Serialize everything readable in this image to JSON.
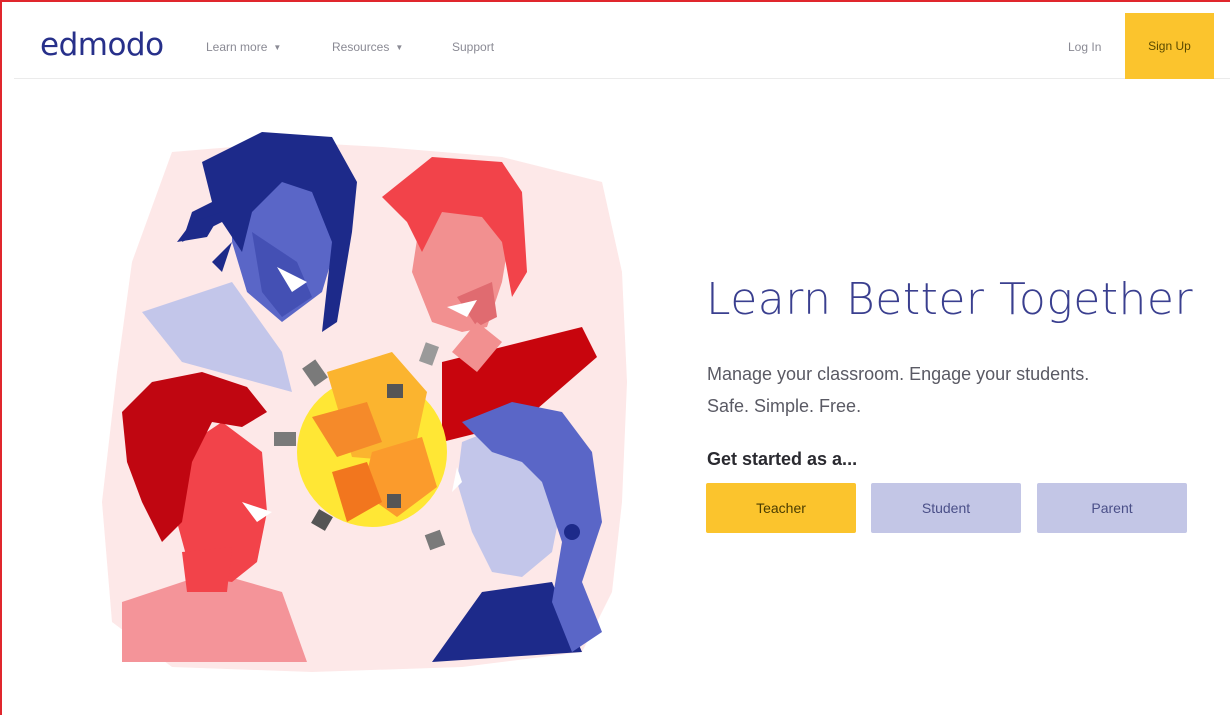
{
  "nav": {
    "logo": "edmodo",
    "links": [
      {
        "label": "Learn more",
        "caret": "▼"
      },
      {
        "label": "Resources",
        "caret": "▼"
      },
      {
        "label": "Support"
      }
    ],
    "login_label": "Log In",
    "signup_label": "Sign Up"
  },
  "hero": {
    "title": "Learn Better Together",
    "subtitle_line1": "Manage your classroom. Engage your students.",
    "subtitle_line2": "Safe. Simple. Free.",
    "get_started": "Get started as a...",
    "roles": [
      "Teacher",
      "Student",
      "Parent"
    ]
  },
  "colors": {
    "brand": "#27308a",
    "accent_yellow": "#fbc42d",
    "role_secondary": "#c3c6e6",
    "frame_border": "#e0262d"
  }
}
